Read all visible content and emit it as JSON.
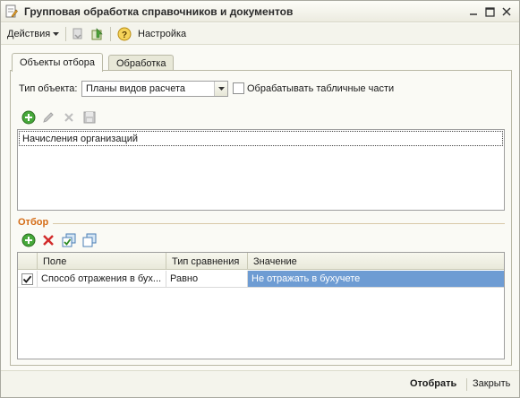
{
  "window": {
    "title": "Групповая обработка справочников и документов",
    "icon": "document-edit-icon"
  },
  "toolbar": {
    "actions_label": "Действия",
    "settings_label": "Настройка"
  },
  "tabs": [
    {
      "label": "Объекты отбора",
      "active": true
    },
    {
      "label": "Обработка",
      "active": false
    }
  ],
  "object_type": {
    "label": "Тип объекта:",
    "value": "Планы видов расчета"
  },
  "process_tabular": {
    "label": "Обрабатывать табличные части",
    "checked": false
  },
  "objects_list": {
    "items": [
      "Начисления организаций"
    ]
  },
  "filter": {
    "title": "Отбор",
    "columns": [
      "Поле",
      "Тип сравнения",
      "Значение"
    ],
    "rows": [
      {
        "checked": true,
        "field": "Способ отражения в бух...",
        "comparison": "Равно",
        "value": "Не отражать в бухучете"
      }
    ]
  },
  "footer": {
    "select_label": "Отобрать",
    "close_label": "Закрыть"
  },
  "colors": {
    "accent": "#d46b15",
    "selection": "#6e9cd3",
    "add_green": "#3d9b2a",
    "delete_red": "#d22b2b"
  }
}
